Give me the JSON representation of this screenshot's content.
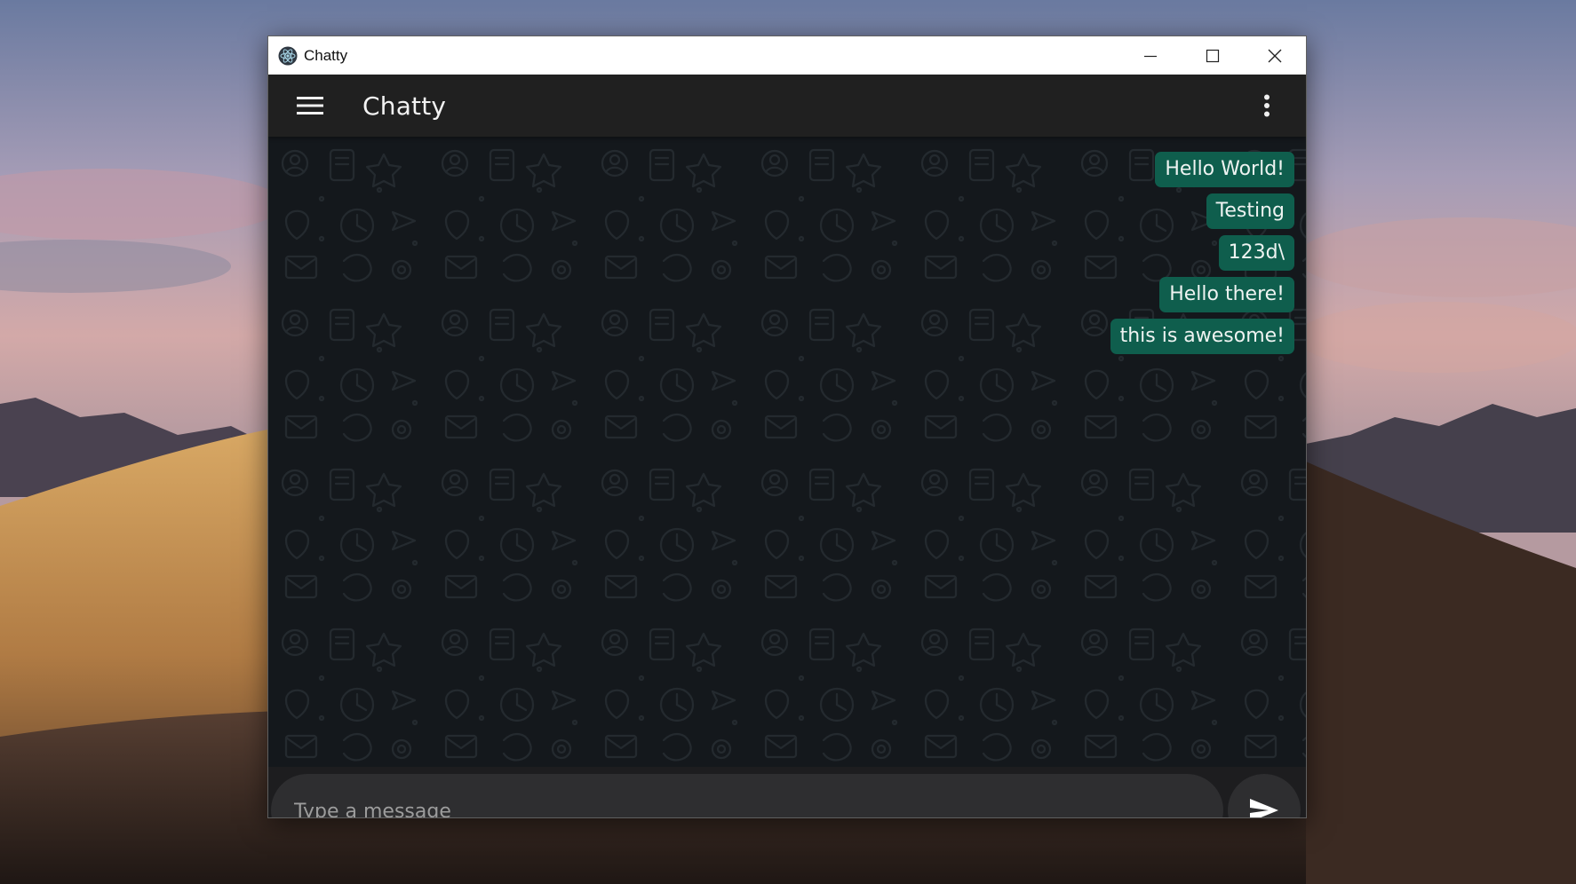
{
  "window": {
    "title": "Chatty",
    "controls": {
      "minimize": "minimize-icon",
      "maximize": "maximize-icon",
      "close": "close-icon"
    }
  },
  "appbar": {
    "title": "Chatty",
    "menu_icon": "hamburger-menu-icon",
    "more_icon": "more-vert-icon"
  },
  "messages": [
    {
      "text": "Hello World!"
    },
    {
      "text": "Testing"
    },
    {
      "text": "123d\\"
    },
    {
      "text": "Hello there!"
    },
    {
      "text": "this is awesome!"
    }
  ],
  "composer": {
    "placeholder": "Type a message",
    "value": "",
    "send_icon": "send-icon"
  },
  "colors": {
    "bubble": "#0f5e4d",
    "appbar": "#202020",
    "chat_background": "#14181c",
    "input": "#2e2e30"
  }
}
